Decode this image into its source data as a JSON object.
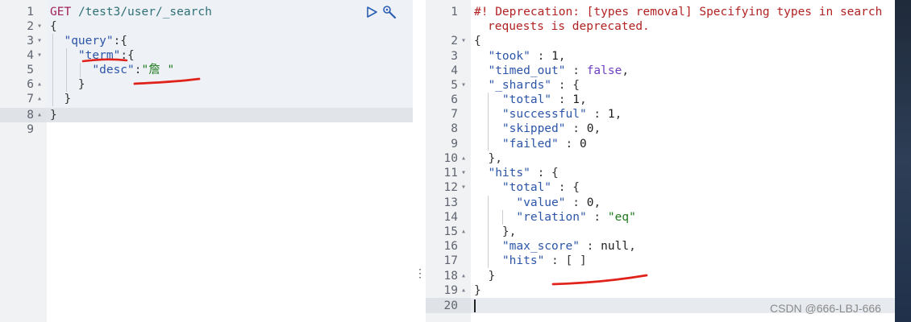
{
  "request": {
    "method": "GET",
    "path": "/test3/user/_search",
    "query_key": "\"query\"",
    "term_key": "\"term\"",
    "desc_key": "\"desc\"",
    "desc_value": "\"詹 \"",
    "line_numbers": [
      "1",
      "2",
      "3",
      "4",
      "5",
      "6",
      "7",
      "8",
      "9"
    ]
  },
  "response": {
    "deprecation_line1": "#! Deprecation: [types removal] Specifying types in search",
    "deprecation_line2": "requests is deprecated.",
    "took_key": "\"took\"",
    "took_value": "1",
    "timed_out_key": "\"timed_out\"",
    "timed_out_value": "false",
    "shards_key": "\"_shards\"",
    "total_key": "\"total\"",
    "total_value": "1",
    "successful_key": "\"successful\"",
    "successful_value": "1",
    "skipped_key": "\"skipped\"",
    "skipped_value": "0",
    "failed_key": "\"failed\"",
    "failed_value": "0",
    "hits_key": "\"hits\"",
    "hits_total_key": "\"total\"",
    "value_key": "\"value\"",
    "value_value": "0",
    "relation_key": "\"relation\"",
    "relation_value": "\"eq\"",
    "max_score_key": "\"max_score\"",
    "max_score_value": "null",
    "inner_hits_key": "\"hits\"",
    "inner_hits_value": "[ ]",
    "line_numbers": [
      "1",
      "2",
      "3",
      "4",
      "5",
      "6",
      "7",
      "8",
      "9",
      "10",
      "11",
      "12",
      "13",
      "14",
      "15",
      "16",
      "17",
      "18",
      "19",
      "20"
    ]
  },
  "watermark": "CSDN @666-LBJ-666",
  "colors": {
    "annotation_red": "#e0221b",
    "method": "#a0225a",
    "key": "#2c55a8",
    "string": "#1f7a1f",
    "comment": "#b22222"
  },
  "icons": [
    "play-icon",
    "wrench-icon",
    "panel-resize-icon"
  ]
}
